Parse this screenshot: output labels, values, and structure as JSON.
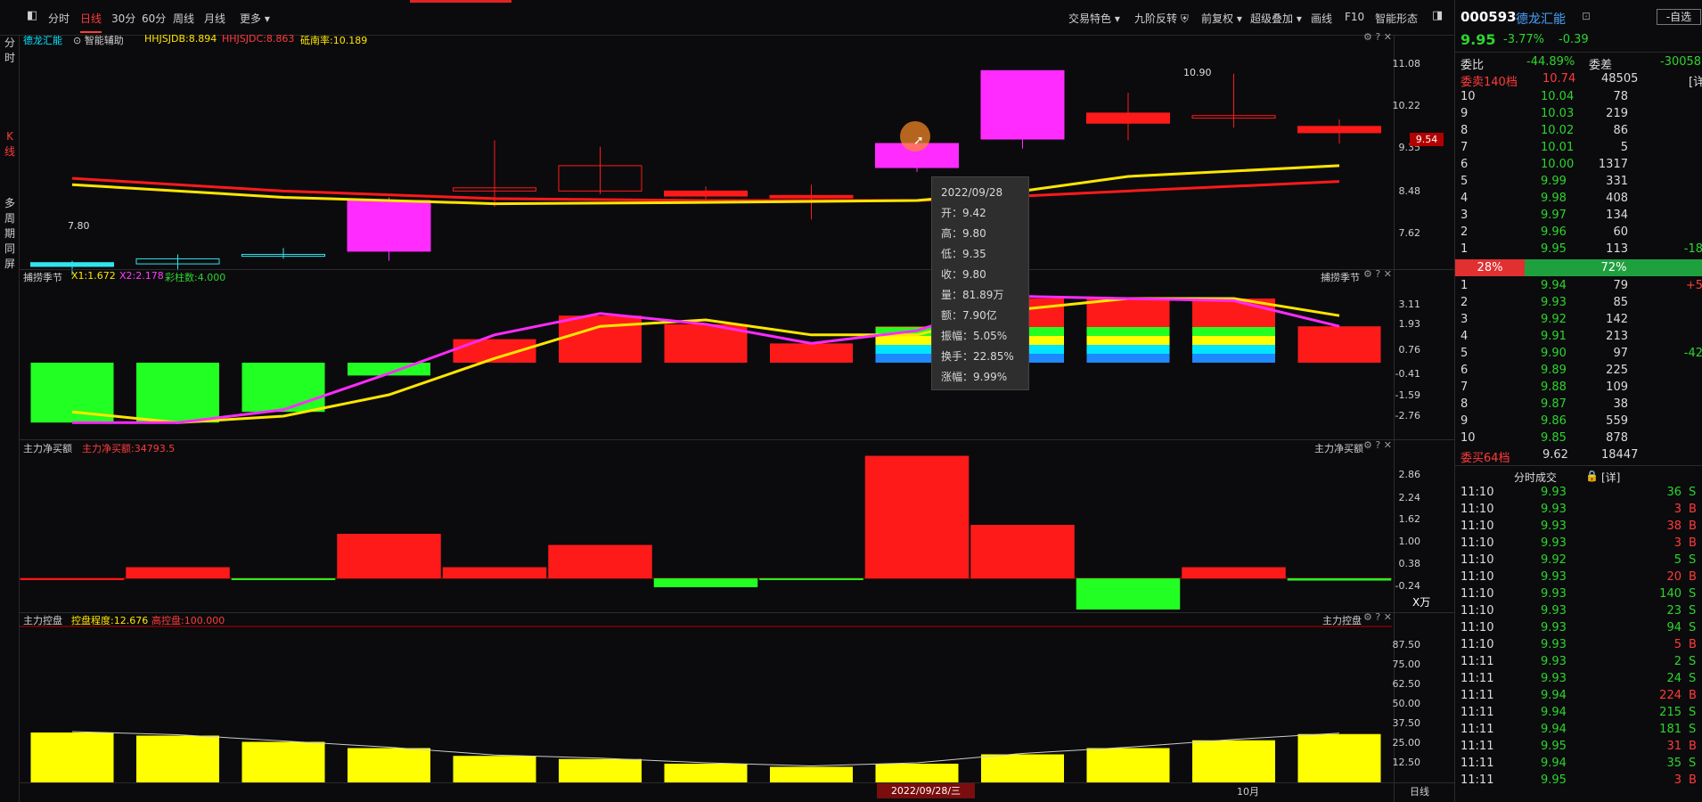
{
  "toolbar": {
    "tabs": [
      "分时",
      "日线",
      "30分",
      "60分",
      "周线",
      "月线",
      "更多"
    ],
    "active_tab": "日线",
    "right_menu": [
      "交易特色",
      "九阶反转",
      "前复权",
      "超级叠加",
      "画线",
      "F10",
      "智能形态"
    ]
  },
  "leftnav": {
    "items": [
      "分时",
      "K线",
      "多周期同屏"
    ]
  },
  "panel1": {
    "name": "德龙汇能",
    "assist": "智能辅助",
    "ind1": "HHJSJDB:8.894",
    "ind2": "HHJSJDC:8.863",
    "ind3": "砥南率:10.189",
    "axis": [
      "11.08",
      "10.22",
      "9.35",
      "8.48",
      "7.62"
    ],
    "price_tag": "9.54",
    "low_label": "7.80",
    "high_label": "10.90"
  },
  "panel2": {
    "name": "捕捞季节",
    "x1": "X1:1.672",
    "x2": "X2:2.178",
    "bars": "彩柱数:4.000",
    "axis": [
      "3.11",
      "1.93",
      "0.76",
      "-0.41",
      "-1.59",
      "-2.76"
    ]
  },
  "panel3": {
    "name": "主力净买额",
    "val": "主力净买额:34793.5",
    "axis": [
      "2.86",
      "2.24",
      "1.62",
      "1.00",
      "0.38",
      "-0.24"
    ],
    "unit": "X万"
  },
  "panel4": {
    "name": "主力控盘",
    "ctrl": "控盘程度:12.676",
    "high": "高控盘:100.000",
    "axis": [
      "87.50",
      "75.00",
      "62.50",
      "50.00",
      "37.50",
      "25.00",
      "12.50"
    ]
  },
  "bottom": {
    "date": "2022/09/28/三",
    "month": "10月",
    "period": "日线"
  },
  "tooltip": {
    "date": "2022/09/28",
    "open": "开：9.42",
    "high": "高：9.80",
    "low": "低：9.35",
    "close": "收：9.80",
    "vol": "量：81.89万",
    "amt": "额：7.90亿",
    "amp": "振幅：5.05%",
    "turn": "换手：22.85%",
    "chg": "涨幅：9.99%"
  },
  "stock": {
    "code": "000593",
    "name": "德龙汇能",
    "button": "-自选",
    "price": "9.95",
    "pct": "-3.77%",
    "chg": "-0.39",
    "weibi_label": "委比",
    "weibi": "-44.89%",
    "weicha_label": "委差",
    "weicha": "-30058",
    "sell_label": "委卖140档",
    "sell_price": "10.74",
    "sell_vol": "48505",
    "buy_label": "委买64档",
    "buy_price": "9.62",
    "buy_vol": "18447",
    "detail": "[详]",
    "ratio_left": "28%",
    "ratio_right": "72%",
    "trade_title": "分时成交",
    "trade_detail": "[详]"
  },
  "asks": [
    [
      "10",
      "10.04",
      "78",
      ""
    ],
    [
      "9",
      "10.03",
      "219",
      ""
    ],
    [
      "8",
      "10.02",
      "86",
      ""
    ],
    [
      "7",
      "10.01",
      "5",
      ""
    ],
    [
      "6",
      "10.00",
      "1317",
      ""
    ],
    [
      "5",
      "9.99",
      "331",
      ""
    ],
    [
      "4",
      "9.98",
      "408",
      ""
    ],
    [
      "3",
      "9.97",
      "134",
      ""
    ],
    [
      "2",
      "9.96",
      "60",
      ""
    ],
    [
      "1",
      "9.95",
      "113",
      "-18"
    ]
  ],
  "bids": [
    [
      "1",
      "9.94",
      "79",
      "+5"
    ],
    [
      "2",
      "9.93",
      "85",
      ""
    ],
    [
      "3",
      "9.92",
      "142",
      ""
    ],
    [
      "4",
      "9.91",
      "213",
      ""
    ],
    [
      "5",
      "9.90",
      "97",
      "-42"
    ],
    [
      "6",
      "9.89",
      "225",
      ""
    ],
    [
      "7",
      "9.88",
      "109",
      ""
    ],
    [
      "8",
      "9.87",
      "38",
      ""
    ],
    [
      "9",
      "9.86",
      "559",
      ""
    ],
    [
      "10",
      "9.85",
      "878",
      ""
    ]
  ],
  "trades": [
    [
      "11:10",
      "9.93",
      "36",
      "S"
    ],
    [
      "11:10",
      "9.93",
      "3",
      "B"
    ],
    [
      "11:10",
      "9.93",
      "38",
      "B"
    ],
    [
      "11:10",
      "9.93",
      "3",
      "B"
    ],
    [
      "11:10",
      "9.92",
      "5",
      "S"
    ],
    [
      "11:10",
      "9.93",
      "20",
      "B"
    ],
    [
      "11:10",
      "9.93",
      "140",
      "S"
    ],
    [
      "11:10",
      "9.93",
      "23",
      "S"
    ],
    [
      "11:10",
      "9.93",
      "94",
      "S"
    ],
    [
      "11:10",
      "9.93",
      "5",
      "B"
    ],
    [
      "11:11",
      "9.93",
      "2",
      "S"
    ],
    [
      "11:11",
      "9.93",
      "24",
      "S"
    ],
    [
      "11:11",
      "9.94",
      "224",
      "B"
    ],
    [
      "11:11",
      "9.94",
      "215",
      "S"
    ],
    [
      "11:11",
      "9.94",
      "181",
      "S"
    ],
    [
      "11:11",
      "9.95",
      "31",
      "B"
    ],
    [
      "11:11",
      "9.94",
      "35",
      "S"
    ],
    [
      "11:11",
      "9.95",
      "3",
      "B"
    ]
  ],
  "chart_data": {
    "type": "candlestick",
    "dates_visible": [
      "2022/09/28"
    ],
    "candles": [
      {
        "o": 7.92,
        "c": 7.86,
        "h": 7.95,
        "l": 7.72
      },
      {
        "o": 7.9,
        "c": 7.98,
        "h": 8.05,
        "l": 7.8
      },
      {
        "o": 8.02,
        "c": 8.05,
        "h": 8.15,
        "l": 7.98
      },
      {
        "o": 8.1,
        "c": 8.9,
        "h": 8.95,
        "l": 7.95
      },
      {
        "o": 9.05,
        "c": 9.1,
        "h": 9.85,
        "l": 8.8
      },
      {
        "o": 9.45,
        "c": 9.05,
        "h": 9.75,
        "l": 9.0
      },
      {
        "o": 9.05,
        "c": 8.97,
        "h": 9.12,
        "l": 8.85
      },
      {
        "o": 8.98,
        "c": 8.94,
        "h": 9.15,
        "l": 8.6
      },
      {
        "o": 9.42,
        "c": 9.8,
        "h": 9.8,
        "l": 9.35
      },
      {
        "o": 9.87,
        "c": 10.95,
        "h": 10.95,
        "l": 9.72
      },
      {
        "o": 10.28,
        "c": 10.12,
        "h": 10.6,
        "l": 9.85
      },
      {
        "o": 10.2,
        "c": 10.24,
        "h": 10.9,
        "l": 10.05
      },
      {
        "o": 10.07,
        "c": 9.97,
        "h": 10.18,
        "l": 9.8
      }
    ],
    "ma_yellow": [
      9.15,
      null,
      8.95,
      null,
      8.85,
      null,
      8.87,
      null,
      8.9,
      9.05,
      9.28,
      null,
      9.45
    ],
    "ma_red": [
      9.25,
      null,
      9.05,
      null,
      8.93,
      null,
      8.9,
      null,
      8.9,
      8.97,
      9.05,
      null,
      9.2
    ],
    "season_bars": [
      -2.8,
      -2.8,
      -2.3,
      -0.6,
      1.1,
      2.2,
      1.8,
      0.9,
      1.7,
      3.0,
      3.0,
      3.0,
      1.7
    ],
    "season_x1": [
      -2.3,
      -2.8,
      -2.5,
      -1.5,
      0.2,
      1.7,
      2.0,
      1.3,
      1.3,
      2.5,
      3.0,
      3.0,
      2.2
    ],
    "season_x2": [
      -2.8,
      -2.8,
      -2.2,
      -0.5,
      1.3,
      2.3,
      1.8,
      0.9,
      1.5,
      3.1,
      3.0,
      2.9,
      1.7
    ],
    "netbuy": [
      0.0,
      0.5,
      -0.05,
      2.0,
      0.5,
      1.5,
      -0.4,
      -0.05,
      5.5,
      2.4,
      -1.4,
      0.5,
      -0.1
    ],
    "control": [
      32,
      30,
      26,
      22,
      17,
      15,
      12,
      10,
      12,
      18,
      22,
      27,
      31
    ]
  }
}
